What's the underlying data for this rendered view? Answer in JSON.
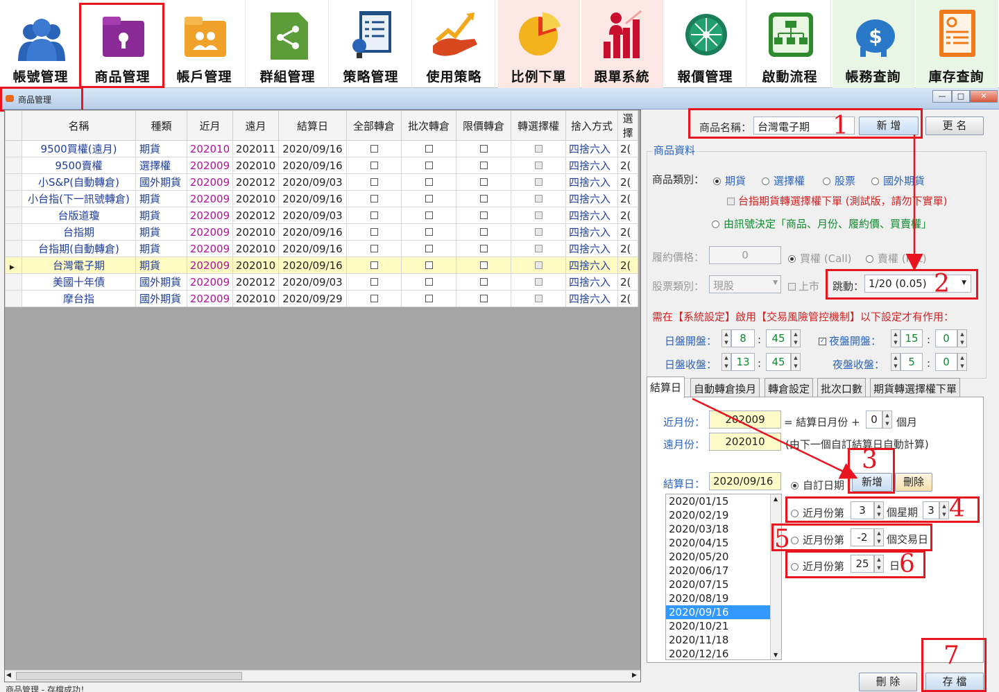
{
  "toolbar": [
    {
      "label": "帳號管理",
      "icon": "users-icon"
    },
    {
      "label": "商品管理",
      "icon": "folder-lock-icon"
    },
    {
      "label": "帳戶管理",
      "icon": "folder-users-icon"
    },
    {
      "label": "群組管理",
      "icon": "share-icon"
    },
    {
      "label": "策略管理",
      "icon": "checklist-icon"
    },
    {
      "label": "使用策略",
      "icon": "hand-chart-icon"
    },
    {
      "label": "比例下單",
      "icon": "pie-chart-icon"
    },
    {
      "label": "跟單系統",
      "icon": "bar-chart-icon"
    },
    {
      "label": "報價管理",
      "icon": "globe-network-icon"
    },
    {
      "label": "啟動流程",
      "icon": "flowchart-icon"
    },
    {
      "label": "帳務查詢",
      "icon": "piggy-bank-icon"
    },
    {
      "label": "庫存查詢",
      "icon": "report-icon"
    }
  ],
  "window": {
    "title": "商品管理",
    "minimize": "—",
    "restore": "□",
    "close": "✕"
  },
  "grid": {
    "columns": [
      "名稱",
      "種類",
      "近月",
      "遠月",
      "結算日",
      "全部轉倉",
      "批次轉倉",
      "限價轉倉",
      "轉選擇權",
      "捨入方式",
      "選擇"
    ],
    "rows": [
      {
        "name": "9500買權(遠月)",
        "type": "期貨",
        "near": "202010",
        "far": "202011",
        "settle": "2020/09/16",
        "round": "四捨六入",
        "extra": "2("
      },
      {
        "name": "9500賣權",
        "type": "選擇權",
        "near": "202009",
        "far": "202010",
        "settle": "2020/09/16",
        "round": "四捨六入",
        "extra": "2("
      },
      {
        "name": "小S&P(自動轉倉)",
        "type": "國外期貨",
        "near": "202009",
        "far": "202012",
        "settle": "2020/09/03",
        "round": "四捨六入",
        "extra": "2("
      },
      {
        "name": "小台指(下一訊號轉倉)",
        "type": "期貨",
        "near": "202009",
        "far": "202010",
        "settle": "2020/09/16",
        "round": "四捨六入",
        "extra": "2("
      },
      {
        "name": "台版道瓊",
        "type": "期貨",
        "near": "202009",
        "far": "202012",
        "settle": "2020/09/03",
        "round": "四捨六入",
        "extra": "2("
      },
      {
        "name": "台指期",
        "type": "期貨",
        "near": "202009",
        "far": "202010",
        "settle": "2020/09/16",
        "round": "四捨六入",
        "extra": "2("
      },
      {
        "name": "台指期(自動轉倉)",
        "type": "期貨",
        "near": "202009",
        "far": "202010",
        "settle": "2020/09/16",
        "round": "四捨六入",
        "extra": "2("
      },
      {
        "name": "台灣電子期",
        "type": "期貨",
        "near": "202009",
        "far": "202010",
        "settle": "2020/09/16",
        "round": "四捨六入",
        "extra": "2("
      },
      {
        "name": "美國十年債",
        "type": "國外期貨",
        "near": "202009",
        "far": "202012",
        "settle": "2020/09/03",
        "round": "四捨六入",
        "extra": "2("
      },
      {
        "name": "摩台指",
        "type": "國外期貨",
        "near": "202009",
        "far": "202010",
        "settle": "2020/09/29",
        "round": "四捨六入",
        "extra": "2("
      }
    ],
    "selected_index": 7
  },
  "status": "商品管理 - 存檔成功！",
  "form": {
    "name_label": "商品名稱：",
    "name_value": "台灣電子期",
    "add_btn": "新 增",
    "rename_btn": "更 名",
    "section": "商品資料",
    "category_label": "商品類別：",
    "categories": [
      "期貨",
      "選擇權",
      "股票",
      "國外期貨"
    ],
    "opt_convert": "台指期貨轉選擇權下單 (測試版，請勿下實單)",
    "opt_signal": "由訊號決定「商品、月份、履約價、買賣權」",
    "strike_label": "履約價格：",
    "strike_value": "0",
    "call": "買權 (Call)",
    "put": "賣權 (Put)",
    "stock_label": "股票類別：",
    "stock_value": "現股",
    "listed": "上市",
    "tick_label": "跳動：",
    "tick_value": "1/20 (0.05)",
    "notice": "需在【系統設定】啟用【交易風險管控機制】以下設定才有作用：",
    "day_open_label": "日盤開盤：",
    "day_open_h": "8",
    "day_open_m": "45",
    "night_open_label": "夜盤開盤：",
    "night_open_h": "15",
    "night_open_m": "0",
    "day_close_label": "日盤收盤：",
    "day_close_h": "13",
    "day_close_m": "45",
    "night_close_label": "夜盤收盤：",
    "night_close_h": "5",
    "night_close_m": "0",
    "colon": ":"
  },
  "tabs": [
    "結算日",
    "自動轉倉換月",
    "轉倉設定",
    "批次口數",
    "期貨轉選擇權下單"
  ],
  "settle_tab": {
    "near_label": "近月份：",
    "near_value": "202009",
    "near_eq": "= 結算日月份 +",
    "near_offset": "0",
    "month_unit": "個月",
    "far_label": "遠月份：",
    "far_value": "202010",
    "far_note": "(由下一個自訂結算日自動計算)",
    "settle_label": "結算日：",
    "settle_value": "2020/09/16",
    "custom": "自訂日期",
    "add": "新增",
    "delete": "刪除",
    "rule_week_prefix": "近月份第",
    "rule_week_n": "3",
    "rule_week_mid": "個星期",
    "rule_week_day": "3",
    "rule_trade_prefix": "近月份第",
    "rule_trade_n": "-2",
    "rule_trade_suffix": "個交易日",
    "rule_day_prefix": "近月份第",
    "rule_day_n": "25",
    "rule_day_suffix": "日",
    "dates": [
      "2020/01/15",
      "2020/02/19",
      "2020/03/18",
      "2020/04/15",
      "2020/05/20",
      "2020/06/17",
      "2020/07/15",
      "2020/08/19",
      "2020/09/16",
      "2020/10/21",
      "2020/11/18",
      "2020/12/16"
    ],
    "selected_date": "2020/09/16"
  },
  "bottom": {
    "delete": "刪 除",
    "save": "存 檔"
  },
  "annotations": [
    "1",
    "2",
    "3",
    "4",
    "5",
    "6",
    "7"
  ],
  "colors": {
    "highlight": "#e8141e",
    "accent_blue": "#2a64c0",
    "green": "#0d8a2e",
    "magenta": "#b0119b",
    "selected_row": "#fffbc2"
  }
}
